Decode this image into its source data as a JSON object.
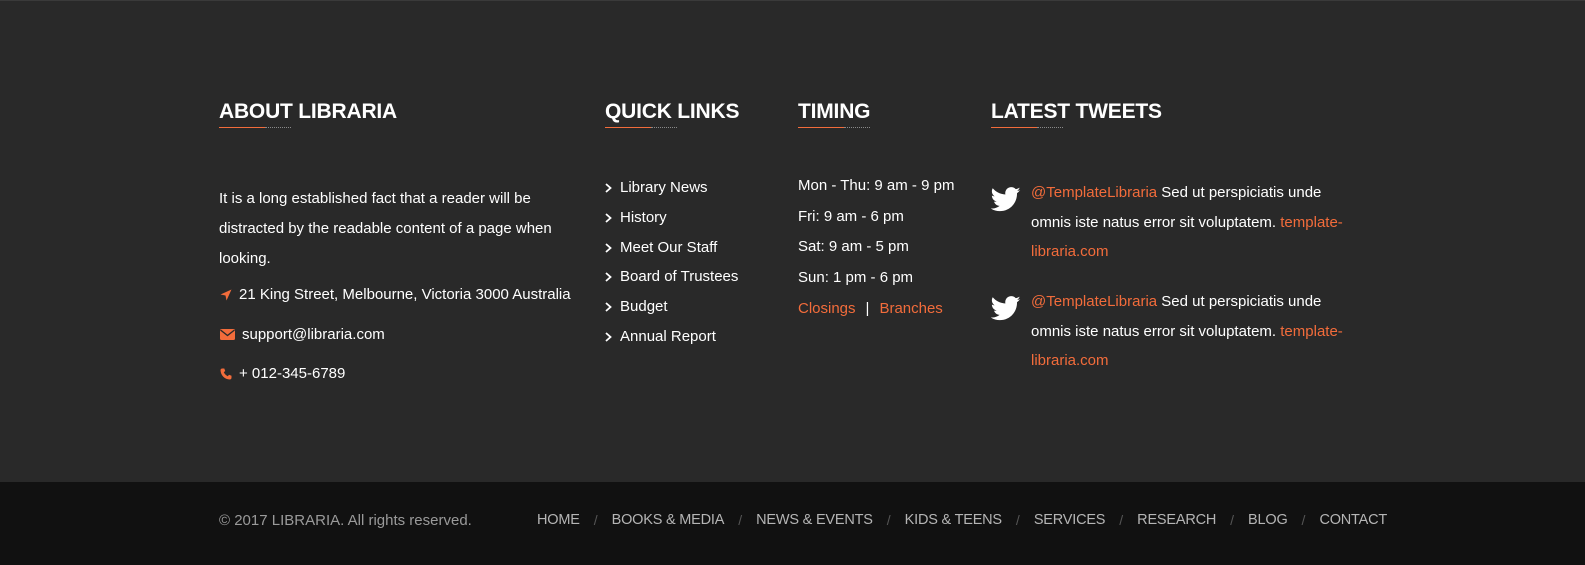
{
  "about": {
    "heading": "ABOUT LIBRARIA",
    "text": "It is a long established fact that a reader will be distracted by the readable content of a page when looking.",
    "address": "21 King Street, Melbourne, Victoria 3000 Australia",
    "email": "support@libraria.com",
    "phone": "+ 012-345-6789"
  },
  "quick_links": {
    "heading": "QUICK LINKS",
    "items": [
      "Library News",
      "History",
      "Meet Our Staff",
      "Board of Trustees",
      "Budget",
      "Annual Report"
    ]
  },
  "timing": {
    "heading": "TIMING",
    "hours": [
      "Mon - Thu: 9 am - 9 pm",
      "Fri: 9 am - 6 pm",
      "Sat: 9 am - 5 pm",
      "Sun: 1 pm - 6 pm"
    ],
    "closings_label": "Closings",
    "separator": "|",
    "branches_label": "Branches"
  },
  "tweets": {
    "heading": "LATEST TWEETS",
    "items": [
      {
        "handle": "@TemplateLibraria",
        "text": " Sed ut perspiciatis unde omnis iste natus error sit voluptatem. ",
        "link": "template-libraria.com"
      },
      {
        "handle": "@TemplateLibraria",
        "text": " Sed ut perspiciatis unde omnis iste natus error sit voluptatem. ",
        "link": "template-libraria.com"
      }
    ]
  },
  "footer_bottom": {
    "copyright": "© 2017 LIBRARIA. All rights reserved.",
    "nav": [
      "HOME",
      "BOOKS & MEDIA",
      "NEWS & EVENTS",
      "KIDS & TEENS",
      "SERVICES",
      "RESEARCH",
      "BLOG",
      "CONTACT"
    ],
    "separator": "/"
  },
  "colors": {
    "accent": "#f26c3b",
    "background_top": "#292929",
    "background_bottom": "#111111"
  },
  "icons": {
    "address": "location-arrow-icon",
    "email": "envelope-icon",
    "phone": "phone-icon",
    "link_bullet": "chevron-right-icon",
    "tweet": "twitter-bird-icon"
  }
}
